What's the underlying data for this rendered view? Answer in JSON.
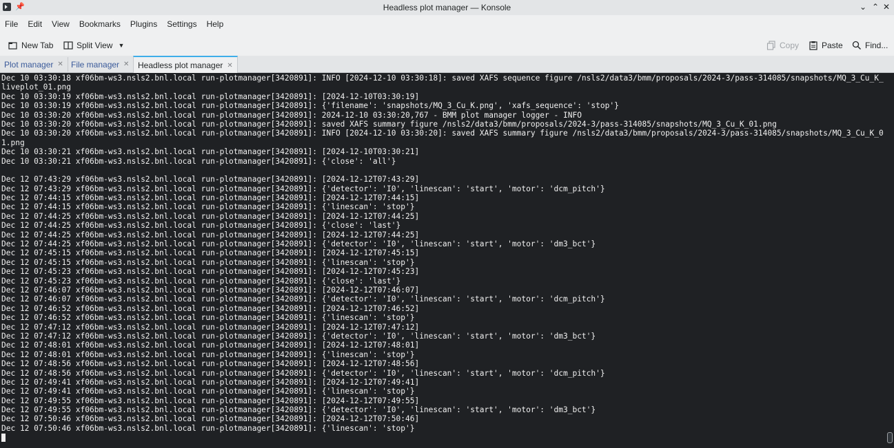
{
  "window": {
    "title": "Headless plot manager — Konsole",
    "controls": {
      "minimize": "⌄",
      "maximize": "⌃",
      "close": "✕"
    }
  },
  "menu": [
    "File",
    "Edit",
    "View",
    "Bookmarks",
    "Plugins",
    "Settings",
    "Help"
  ],
  "toolbar": {
    "new_tab": "New Tab",
    "split_view": "Split View",
    "copy": "Copy",
    "paste": "Paste",
    "find": "Find..."
  },
  "tabs": [
    {
      "label": "Plot manager",
      "active": false
    },
    {
      "label": "File manager",
      "active": false
    },
    {
      "label": "Headless plot manager",
      "active": true
    }
  ],
  "terminal": {
    "lines": [
      "Dec 10 03:30:18 xf06bm-ws3.nsls2.bnl.local run-plotmanager[3420891]: INFO [2024-12-10 03:30:18]: saved XAFS sequence figure /nsls2/data3/bmm/proposals/2024-3/pass-314085/snapshots/MQ_3_Cu_K_",
      "liveplot_01.png",
      "Dec 10 03:30:19 xf06bm-ws3.nsls2.bnl.local run-plotmanager[3420891]: [2024-12-10T03:30:19]",
      "Dec 10 03:30:19 xf06bm-ws3.nsls2.bnl.local run-plotmanager[3420891]: {'filename': 'snapshots/MQ_3_Cu_K.png', 'xafs_sequence': 'stop'}",
      "Dec 10 03:30:20 xf06bm-ws3.nsls2.bnl.local run-plotmanager[3420891]: 2024-12-10 03:30:20,767 - BMM plot manager logger - INFO",
      "Dec 10 03:30:20 xf06bm-ws3.nsls2.bnl.local run-plotmanager[3420891]: saved XAFS summary figure /nsls2/data3/bmm/proposals/2024-3/pass-314085/snapshots/MQ_3_Cu_K_01.png",
      "Dec 10 03:30:20 xf06bm-ws3.nsls2.bnl.local run-plotmanager[3420891]: INFO [2024-12-10 03:30:20]: saved XAFS summary figure /nsls2/data3/bmm/proposals/2024-3/pass-314085/snapshots/MQ_3_Cu_K_0",
      "1.png",
      "Dec 10 03:30:21 xf06bm-ws3.nsls2.bnl.local run-plotmanager[3420891]: [2024-12-10T03:30:21]",
      "Dec 10 03:30:21 xf06bm-ws3.nsls2.bnl.local run-plotmanager[3420891]: {'close': 'all'}",
      "",
      "Dec 12 07:43:29 xf06bm-ws3.nsls2.bnl.local run-plotmanager[3420891]: [2024-12-12T07:43:29]",
      "Dec 12 07:43:29 xf06bm-ws3.nsls2.bnl.local run-plotmanager[3420891]: {'detector': 'I0', 'linescan': 'start', 'motor': 'dcm_pitch'}",
      "Dec 12 07:44:15 xf06bm-ws3.nsls2.bnl.local run-plotmanager[3420891]: [2024-12-12T07:44:15]",
      "Dec 12 07:44:15 xf06bm-ws3.nsls2.bnl.local run-plotmanager[3420891]: {'linescan': 'stop'}",
      "Dec 12 07:44:25 xf06bm-ws3.nsls2.bnl.local run-plotmanager[3420891]: [2024-12-12T07:44:25]",
      "Dec 12 07:44:25 xf06bm-ws3.nsls2.bnl.local run-plotmanager[3420891]: {'close': 'last'}",
      "Dec 12 07:44:25 xf06bm-ws3.nsls2.bnl.local run-plotmanager[3420891]: [2024-12-12T07:44:25]",
      "Dec 12 07:44:25 xf06bm-ws3.nsls2.bnl.local run-plotmanager[3420891]: {'detector': 'I0', 'linescan': 'start', 'motor': 'dm3_bct'}",
      "Dec 12 07:45:15 xf06bm-ws3.nsls2.bnl.local run-plotmanager[3420891]: [2024-12-12T07:45:15]",
      "Dec 12 07:45:15 xf06bm-ws3.nsls2.bnl.local run-plotmanager[3420891]: {'linescan': 'stop'}",
      "Dec 12 07:45:23 xf06bm-ws3.nsls2.bnl.local run-plotmanager[3420891]: [2024-12-12T07:45:23]",
      "Dec 12 07:45:23 xf06bm-ws3.nsls2.bnl.local run-plotmanager[3420891]: {'close': 'last'}",
      "Dec 12 07:46:07 xf06bm-ws3.nsls2.bnl.local run-plotmanager[3420891]: [2024-12-12T07:46:07]",
      "Dec 12 07:46:07 xf06bm-ws3.nsls2.bnl.local run-plotmanager[3420891]: {'detector': 'I0', 'linescan': 'start', 'motor': 'dcm_pitch'}",
      "Dec 12 07:46:52 xf06bm-ws3.nsls2.bnl.local run-plotmanager[3420891]: [2024-12-12T07:46:52]",
      "Dec 12 07:46:52 xf06bm-ws3.nsls2.bnl.local run-plotmanager[3420891]: {'linescan': 'stop'}",
      "Dec 12 07:47:12 xf06bm-ws3.nsls2.bnl.local run-plotmanager[3420891]: [2024-12-12T07:47:12]",
      "Dec 12 07:47:12 xf06bm-ws3.nsls2.bnl.local run-plotmanager[3420891]: {'detector': 'I0', 'linescan': 'start', 'motor': 'dm3_bct'}",
      "Dec 12 07:48:01 xf06bm-ws3.nsls2.bnl.local run-plotmanager[3420891]: [2024-12-12T07:48:01]",
      "Dec 12 07:48:01 xf06bm-ws3.nsls2.bnl.local run-plotmanager[3420891]: {'linescan': 'stop'}",
      "Dec 12 07:48:56 xf06bm-ws3.nsls2.bnl.local run-plotmanager[3420891]: [2024-12-12T07:48:56]",
      "Dec 12 07:48:56 xf06bm-ws3.nsls2.bnl.local run-plotmanager[3420891]: {'detector': 'I0', 'linescan': 'start', 'motor': 'dcm_pitch'}",
      "Dec 12 07:49:41 xf06bm-ws3.nsls2.bnl.local run-plotmanager[3420891]: [2024-12-12T07:49:41]",
      "Dec 12 07:49:41 xf06bm-ws3.nsls2.bnl.local run-plotmanager[3420891]: {'linescan': 'stop'}",
      "Dec 12 07:49:55 xf06bm-ws3.nsls2.bnl.local run-plotmanager[3420891]: [2024-12-12T07:49:55]",
      "Dec 12 07:49:55 xf06bm-ws3.nsls2.bnl.local run-plotmanager[3420891]: {'detector': 'I0', 'linescan': 'start', 'motor': 'dm3_bct'}",
      "Dec 12 07:50:46 xf06bm-ws3.nsls2.bnl.local run-plotmanager[3420891]: [2024-12-12T07:50:46]",
      "Dec 12 07:50:46 xf06bm-ws3.nsls2.bnl.local run-plotmanager[3420891]: {'linescan': 'stop'}"
    ]
  },
  "colors": {
    "terminal_bg": "#1f2124",
    "terminal_fg": "#f0f0f0",
    "accent": "#3daee9",
    "tab_link": "#3a5a9a"
  }
}
